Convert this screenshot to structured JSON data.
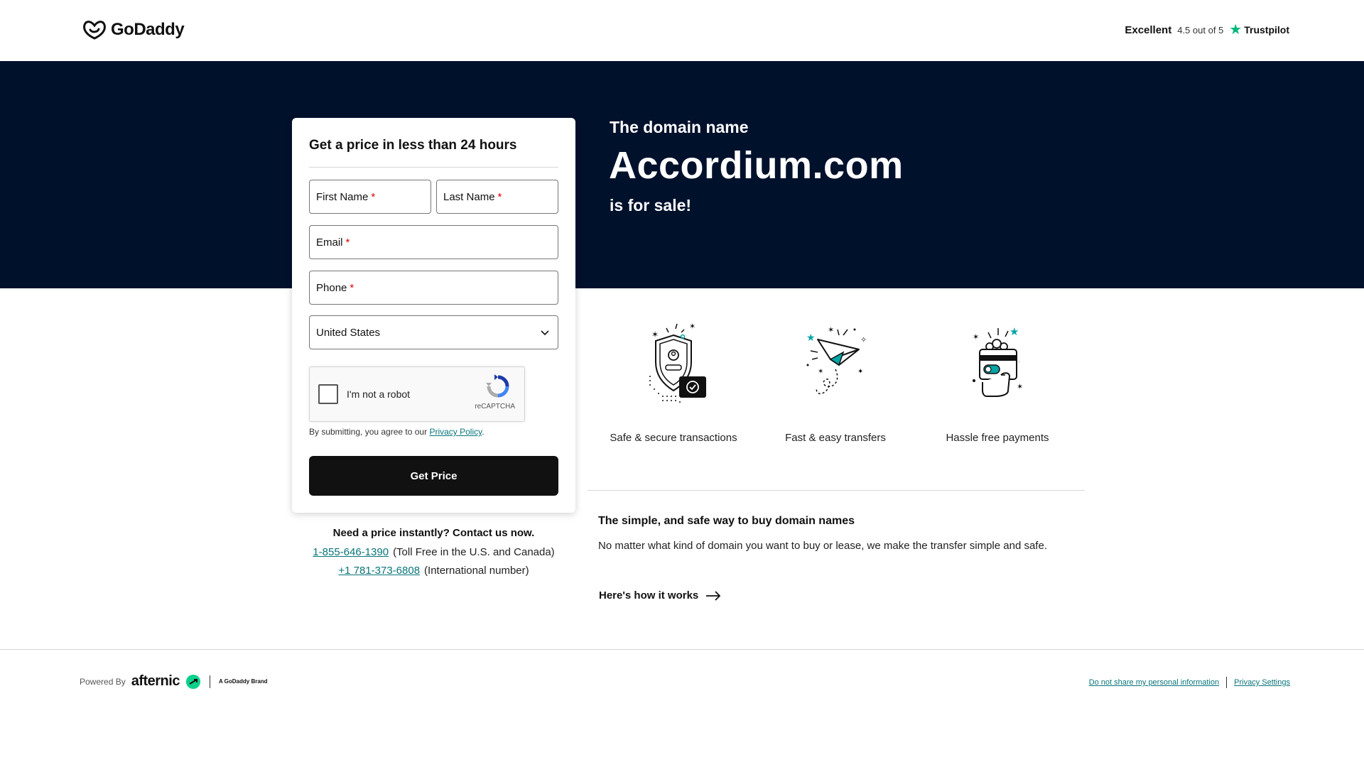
{
  "header": {
    "logo_text": "GoDaddy",
    "trust_rating": "Excellent",
    "trust_score": "4.5 out of 5",
    "trust_brand": "Trustpilot",
    "trust_color": "#00b67a"
  },
  "hero": {
    "subtitle": "The domain name",
    "domain": "Accordium.com",
    "tagline": "is for sale!",
    "background": "#00112c"
  },
  "form": {
    "title": "Get a price in less than 24 hours",
    "first_name_label": "First Name",
    "last_name_label": "Last Name",
    "email_label": "Email",
    "phone_label": "Phone",
    "required_mark": "*",
    "country_value": "United States",
    "captcha_label": "I'm not a robot",
    "captcha_brand": "reCAPTCHA",
    "agree_prefix": "By submitting, you agree to our",
    "privacy_link": "Privacy Policy",
    "agree_suffix": ".",
    "submit_label": "Get Price"
  },
  "contact": {
    "title": "Need a price instantly? Contact us now.",
    "phone_us": "1-855-646-1390",
    "phone_us_note": "(Toll Free in the U.S. and Canada)",
    "phone_intl": "+1 781-373-6808",
    "phone_intl_note": "(International number)",
    "link_color": "#09757a"
  },
  "features": [
    {
      "label": "Safe & secure transactions",
      "icon": "shield-icon"
    },
    {
      "label": "Fast & easy transfers",
      "icon": "paper-plane-icon"
    },
    {
      "label": "Hassle free payments",
      "icon": "wallet-card-icon"
    }
  ],
  "info": {
    "title": "The simple, and safe way to buy domain names",
    "body": "No matter what kind of domain you want to buy or lease, we make the transfer simple and safe.",
    "cta": "Here's how it works"
  },
  "footer": {
    "powered_by": "Powered By",
    "afternic": "afternic",
    "godaddy_brand": "A GoDaddy Brand",
    "do_not_share": "Do not share my personal information",
    "privacy_settings": "Privacy Settings"
  }
}
